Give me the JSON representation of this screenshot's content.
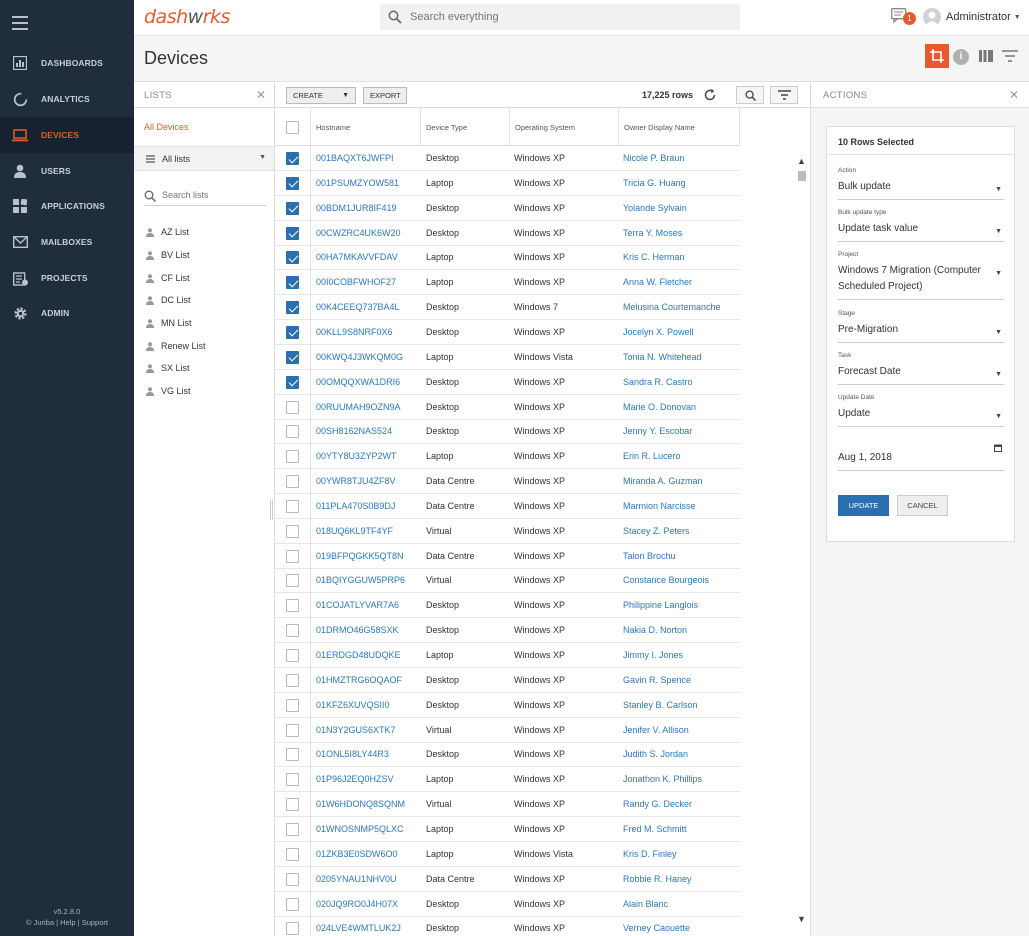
{
  "app": {
    "logo_left": "dash",
    "logo_mid": "w",
    "logo_right": "rks",
    "search_placeholder": "Search everything",
    "notif_count": "1",
    "user_name": "Administrator",
    "accent_color": "#e85a2c"
  },
  "nav": {
    "items": [
      {
        "label": "DASHBOARDS",
        "icon": "dashboard-icon"
      },
      {
        "label": "ANALYTICS",
        "icon": "analytics-icon"
      },
      {
        "label": "DEVICES",
        "icon": "laptop-icon",
        "active": true
      },
      {
        "label": "USERS",
        "icon": "user-icon"
      },
      {
        "label": "APPLICATIONS",
        "icon": "applications-icon"
      },
      {
        "label": "MAILBOXES",
        "icon": "mail-icon"
      },
      {
        "label": "PROJECTS",
        "icon": "projects-icon"
      },
      {
        "label": "ADMIN",
        "icon": "gear-icon"
      }
    ],
    "version": "v5.2.8.0",
    "footer_links": "© Juriba | Help | Support"
  },
  "page": {
    "title": "Devices"
  },
  "lists": {
    "header": "LISTS",
    "all_devices": "All Devices",
    "all_lists": "All lists",
    "search_placeholder": "Search lists",
    "items": [
      "AZ List",
      "BV List",
      "CF List",
      "DC List",
      "MN List",
      "Renew List",
      "SX List",
      "VG List"
    ]
  },
  "toolbar": {
    "create_label": "CREATE",
    "export_label": "EXPORT",
    "row_count": "17,225 rows"
  },
  "grid": {
    "columns": [
      "Hostname",
      "Device Type",
      "Operating System",
      "Owner Display Name"
    ],
    "rows": [
      {
        "checked": true,
        "host": "001BAQXT6JWFPI",
        "type": "Desktop",
        "os": "Windows XP",
        "owner": "Nicole P. Braun"
      },
      {
        "checked": true,
        "host": "001PSUMZYOW581",
        "type": "Laptop",
        "os": "Windows XP",
        "owner": "Tricia G. Huang"
      },
      {
        "checked": true,
        "host": "00BDM1JUR8IF419",
        "type": "Desktop",
        "os": "Windows XP",
        "owner": "Yolande Sylvain"
      },
      {
        "checked": true,
        "host": "00CWZRC4UK6W20",
        "type": "Desktop",
        "os": "Windows XP",
        "owner": "Terra Y. Moses"
      },
      {
        "checked": true,
        "host": "00HA7MKAVVFDAV",
        "type": "Laptop",
        "os": "Windows XP",
        "owner": "Kris C. Herman"
      },
      {
        "checked": true,
        "host": "00I0COBFWHOF27",
        "type": "Laptop",
        "os": "Windows XP",
        "owner": "Anna W. Fletcher"
      },
      {
        "checked": true,
        "host": "00K4CEEQ737BA4L",
        "type": "Desktop",
        "os": "Windows 7",
        "owner": "Melusina Courtemanche"
      },
      {
        "checked": true,
        "host": "00KLL9S8NRF0X6",
        "type": "Desktop",
        "os": "Windows XP",
        "owner": "Jocelyn X. Powell"
      },
      {
        "checked": true,
        "host": "00KWQ4J3WKQM0G",
        "type": "Laptop",
        "os": "Windows Vista",
        "owner": "Tonia N. Whitehead"
      },
      {
        "checked": true,
        "host": "00OMQQXWA1DRI6",
        "type": "Desktop",
        "os": "Windows XP",
        "owner": "Sandra R. Castro"
      },
      {
        "checked": false,
        "host": "00RUUMAH9OZN9A",
        "type": "Desktop",
        "os": "Windows XP",
        "owner": "Marie O. Donovan"
      },
      {
        "checked": false,
        "host": "00SH8162NAS524",
        "type": "Desktop",
        "os": "Windows XP",
        "owner": "Jenny Y. Escobar"
      },
      {
        "checked": false,
        "host": "00YTY8U3ZYP2WT",
        "type": "Laptop",
        "os": "Windows XP",
        "owner": "Erin R. Lucero"
      },
      {
        "checked": false,
        "host": "00YWR8TJU4ZF8V",
        "type": "Data Centre",
        "os": "Windows XP",
        "owner": "Miranda A. Guzman"
      },
      {
        "checked": false,
        "host": "011PLA470S0B9DJ",
        "type": "Data Centre",
        "os": "Windows XP",
        "owner": "Marmion Narcisse"
      },
      {
        "checked": false,
        "host": "018UQ6KL9TF4YF",
        "type": "Virtual",
        "os": "Windows XP",
        "owner": "Stacey Z. Peters"
      },
      {
        "checked": false,
        "host": "019BFPQGKK5QT8N",
        "type": "Data Centre",
        "os": "Windows XP",
        "owner": "Talon Brochu"
      },
      {
        "checked": false,
        "host": "01BQIYGGUW5PRP6",
        "type": "Virtual",
        "os": "Windows XP",
        "owner": "Constance Bourgeois"
      },
      {
        "checked": false,
        "host": "01COJATLYVAR7A6",
        "type": "Desktop",
        "os": "Windows XP",
        "owner": "Philippine Langlois"
      },
      {
        "checked": false,
        "host": "01DRMO46G58SXK",
        "type": "Desktop",
        "os": "Windows XP",
        "owner": "Nakia D. Norton"
      },
      {
        "checked": false,
        "host": "01ERDGD48UDQKE",
        "type": "Laptop",
        "os": "Windows XP",
        "owner": "Jimmy I. Jones"
      },
      {
        "checked": false,
        "host": "01HMZTRG6OQAOF",
        "type": "Desktop",
        "os": "Windows XP",
        "owner": "Gavin R. Spence"
      },
      {
        "checked": false,
        "host": "01KFZ6XUVQSII0",
        "type": "Desktop",
        "os": "Windows XP",
        "owner": "Stanley B. Carlson"
      },
      {
        "checked": false,
        "host": "01N3Y2GUS6XTK7",
        "type": "Virtual",
        "os": "Windows XP",
        "owner": "Jenifer V. Allison"
      },
      {
        "checked": false,
        "host": "01ONL5I8LY44R3",
        "type": "Desktop",
        "os": "Windows XP",
        "owner": "Judith S. Jordan"
      },
      {
        "checked": false,
        "host": "01P96J2EQ0HZSV",
        "type": "Laptop",
        "os": "Windows XP",
        "owner": "Jonathon K. Phillips"
      },
      {
        "checked": false,
        "host": "01W6HDONQ8SQNM",
        "type": "Virtual",
        "os": "Windows XP",
        "owner": "Randy G. Decker"
      },
      {
        "checked": false,
        "host": "01WNOSNMP5QLXC",
        "type": "Laptop",
        "os": "Windows XP",
        "owner": "Fred M. Schmitt"
      },
      {
        "checked": false,
        "host": "01ZKB3E0SDW6O0",
        "type": "Laptop",
        "os": "Windows Vista",
        "owner": "Kris D. Finley"
      },
      {
        "checked": false,
        "host": "0205YNAU1NHV0U",
        "type": "Data Centre",
        "os": "Windows XP",
        "owner": "Robbie R. Haney"
      },
      {
        "checked": false,
        "host": "020JQ9RO0J4H07X",
        "type": "Desktop",
        "os": "Windows XP",
        "owner": "Alain Blanc"
      },
      {
        "checked": false,
        "host": "024LVE4WMTLUK2J",
        "type": "Desktop",
        "os": "Windows XP",
        "owner": "Verney Caouette"
      }
    ]
  },
  "actions": {
    "header": "ACTIONS",
    "card_title": "10 Rows Selected",
    "action_label": "Action",
    "action_value": "Bulk update",
    "bulk_type_label": "Bulk update type",
    "bulk_type_value": "Update task value",
    "project_label": "Project",
    "project_value": "Windows 7 Migration (Computer Scheduled Project)",
    "stage_label": "Stage",
    "stage_value": "Pre-Migration",
    "task_label": "Task",
    "task_value": "Forecast Date",
    "update_date_label": "Update Date",
    "update_date_value": "Update",
    "date_value": "Aug 1, 2018",
    "update_button": "UPDATE",
    "cancel_button": "CANCEL"
  }
}
